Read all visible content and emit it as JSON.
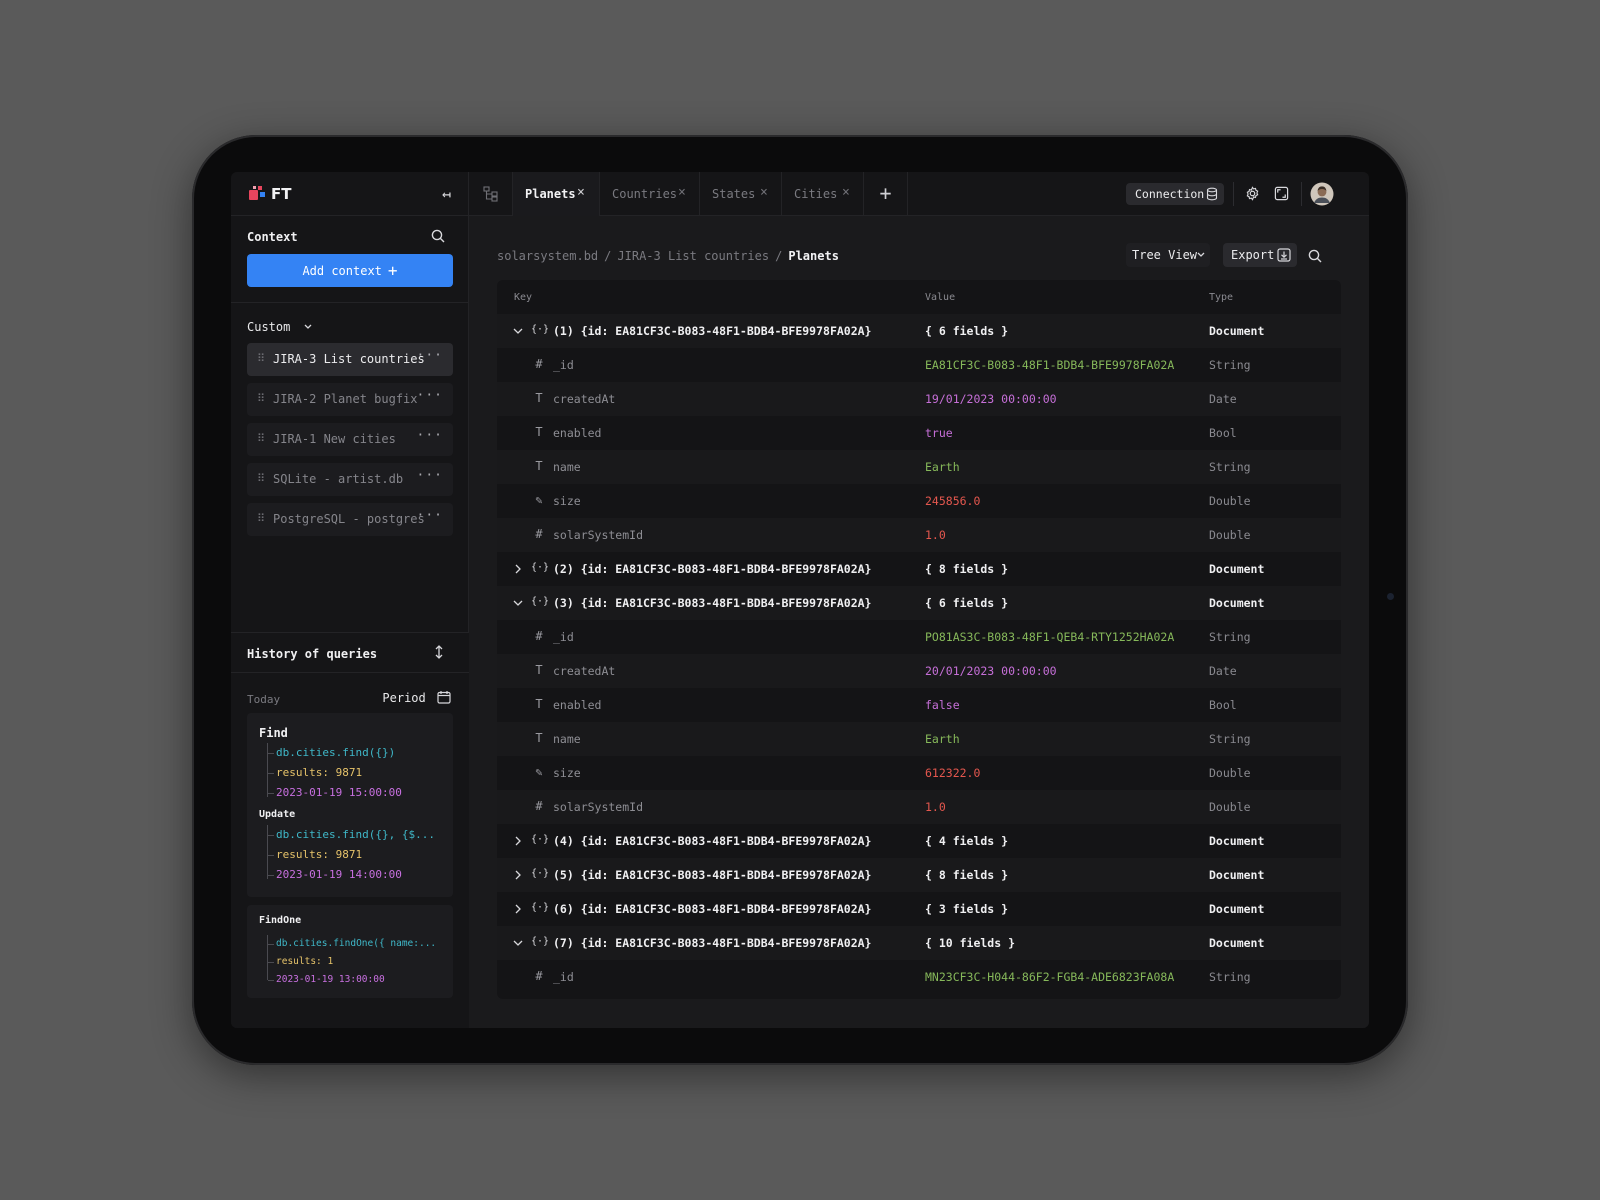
{
  "app": {
    "logo_text": "FT"
  },
  "sidebar": {
    "context_title": "Context",
    "add_context_label": "Add context",
    "custom_label": "Custom",
    "items": [
      {
        "label": "JIRA-3 List countries",
        "active": true
      },
      {
        "label": "JIRA-2 Planet bugfix",
        "active": false
      },
      {
        "label": "JIRA-1 New cities",
        "active": false
      },
      {
        "label": "SQLite - artist.db",
        "active": false
      },
      {
        "label": "PostgreSQL - postgres",
        "active": false
      }
    ],
    "history": {
      "title": "History of queries",
      "today_label": "Today",
      "period_label": "Period",
      "groups": [
        {
          "title": "Find",
          "query": "db.cities.find({})",
          "results": "results: 9871",
          "timestamp": "2023-01-19 15:00:00"
        },
        {
          "title": "Update",
          "query": "db.cities.find({}, {$...",
          "results": "results: 9871",
          "timestamp": "2023-01-19 14:00:00"
        },
        {
          "title": "FindOne",
          "query": "db.cities.findOne({ name:...",
          "results": "results: 1",
          "timestamp": "2023-01-19 13:00:00"
        }
      ]
    }
  },
  "tabs": [
    {
      "label": "Planets",
      "active": true
    },
    {
      "label": "Countries",
      "active": false
    },
    {
      "label": "States",
      "active": false
    },
    {
      "label": "Cities",
      "active": false
    }
  ],
  "toolbar": {
    "connection_label": "Connection"
  },
  "breadcrumb": [
    "solarsystem.bd",
    "JIRA-3 List countries",
    "Planets"
  ],
  "view": {
    "tree_view_label": "Tree View",
    "export_label": "Export"
  },
  "table": {
    "headers": {
      "key": "Key",
      "value": "Value",
      "type": "Type"
    },
    "rows": [
      {
        "kind": "doc",
        "expanded": true,
        "key": "(1) {id: EA81CF3C-B083-48F1-BDB4-BFE9978FA02A}",
        "value": "{ 6 fields }",
        "type": "Document"
      },
      {
        "kind": "field",
        "icon": "hash",
        "key": "_id",
        "value": "EA81CF3C-B083-48F1-BDB4-BFE9978FA02A",
        "vclass": "v-string",
        "type": "String"
      },
      {
        "kind": "field",
        "icon": "text",
        "key": "createdAt",
        "value": "19/01/2023 00:00:00",
        "vclass": "v-date",
        "type": "Date"
      },
      {
        "kind": "field",
        "icon": "text",
        "key": "enabled",
        "value": "true",
        "vclass": "v-bool",
        "type": "Bool"
      },
      {
        "kind": "field",
        "icon": "text",
        "key": "name",
        "value": "Earth",
        "vclass": "v-string",
        "type": "String"
      },
      {
        "kind": "field",
        "icon": "edit",
        "key": "size",
        "value": "245856.0",
        "vclass": "v-number",
        "type": "Double"
      },
      {
        "kind": "field",
        "icon": "hash",
        "key": "solarSystemId",
        "value": "1.0",
        "vclass": "v-number",
        "type": "Double"
      },
      {
        "kind": "doc",
        "expanded": false,
        "key": "(2) {id: EA81CF3C-B083-48F1-BDB4-BFE9978FA02A}",
        "value": "{ 8 fields }",
        "type": "Document"
      },
      {
        "kind": "doc",
        "expanded": true,
        "key": "(3) {id: EA81CF3C-B083-48F1-BDB4-BFE9978FA02A}",
        "value": "{ 6 fields }",
        "type": "Document"
      },
      {
        "kind": "field",
        "icon": "hash",
        "key": "_id",
        "value": "PO81AS3C-B083-48F1-QEB4-RTY1252HA02A",
        "vclass": "v-string",
        "type": "String"
      },
      {
        "kind": "field",
        "icon": "text",
        "key": "createdAt",
        "value": "20/01/2023 00:00:00",
        "vclass": "v-date",
        "type": "Date"
      },
      {
        "kind": "field",
        "icon": "text",
        "key": "enabled",
        "value": "false",
        "vclass": "v-bool",
        "type": "Bool"
      },
      {
        "kind": "field",
        "icon": "text",
        "key": "name",
        "value": "Earth",
        "vclass": "v-string",
        "type": "String"
      },
      {
        "kind": "field",
        "icon": "edit",
        "key": "size",
        "value": "612322.0",
        "vclass": "v-number",
        "type": "Double"
      },
      {
        "kind": "field",
        "icon": "hash",
        "key": "solarSystemId",
        "value": "1.0",
        "vclass": "v-number",
        "type": "Double"
      },
      {
        "kind": "doc",
        "expanded": false,
        "key": "(4) {id: EA81CF3C-B083-48F1-BDB4-BFE9978FA02A}",
        "value": "{ 4 fields }",
        "type": "Document"
      },
      {
        "kind": "doc",
        "expanded": false,
        "key": "(5) {id: EA81CF3C-B083-48F1-BDB4-BFE9978FA02A}",
        "value": "{ 8 fields }",
        "type": "Document"
      },
      {
        "kind": "doc",
        "expanded": false,
        "key": "(6) {id: EA81CF3C-B083-48F1-BDB4-BFE9978FA02A}",
        "value": "{ 3 fields }",
        "type": "Document"
      },
      {
        "kind": "doc",
        "expanded": true,
        "key": "(7) {id: EA81CF3C-B083-48F1-BDB4-BFE9978FA02A}",
        "value": "{ 10 fields }",
        "type": "Document"
      },
      {
        "kind": "field",
        "icon": "hash",
        "key": "_id",
        "value": "MN23CF3C-H044-86F2-FGB4-ADE6823FA08A",
        "vclass": "v-string",
        "type": "String"
      }
    ]
  },
  "colors": {
    "accent": "#3483f4",
    "string": "#86b85a",
    "date": "#c66fd8",
    "number": "#e4574e",
    "query": "#3fb8c9",
    "results": "#e6c36a"
  }
}
